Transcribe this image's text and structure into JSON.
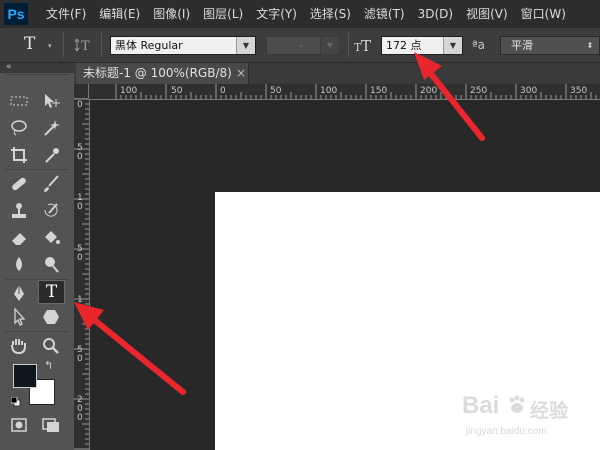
{
  "app": {
    "logo": "Ps",
    "menus": [
      "文件(F)",
      "编辑(E)",
      "图像(I)",
      "图层(L)",
      "文字(Y)",
      "选择(S)",
      "滤镜(T)",
      "3D(D)",
      "视图(V)",
      "窗口(W)"
    ]
  },
  "options_bar": {
    "tool_glyph": "T",
    "font_family": "黑体 Regular",
    "font_style": "-",
    "font_size": "172 点",
    "antialias_label": "ªa",
    "antialias": "平滑"
  },
  "panel": {
    "collapse": "«"
  },
  "document": {
    "tab_title": "未标题-1 @ 100%(RGB/8)",
    "close": "×"
  },
  "ruler": {
    "h_labels": [
      "100",
      "50",
      "0",
      "50",
      "100",
      "150",
      "200",
      "250",
      "300",
      "350"
    ],
    "v_labels": [
      "0",
      "5",
      "0",
      "1",
      "0",
      "5",
      "0"
    ],
    "v_labels_lower": [
      "1",
      "5",
      "0",
      "2",
      "0",
      "0"
    ]
  },
  "tools": {
    "active": "horizontal-type-tool",
    "type_tool_glyph": "T"
  },
  "watermark": {
    "brand": "Bai",
    "brand_suffix": "经验",
    "url": "jingyan.baidu.com"
  },
  "colors": {
    "menubar": "#2d2d2d",
    "optbar": "#3d3d3d",
    "workspace": "#282828",
    "canvas": "#ffffff",
    "annotation_arrow": "#e8262c",
    "foreground_color": "#0e1620",
    "background_color": "#ffffff"
  }
}
